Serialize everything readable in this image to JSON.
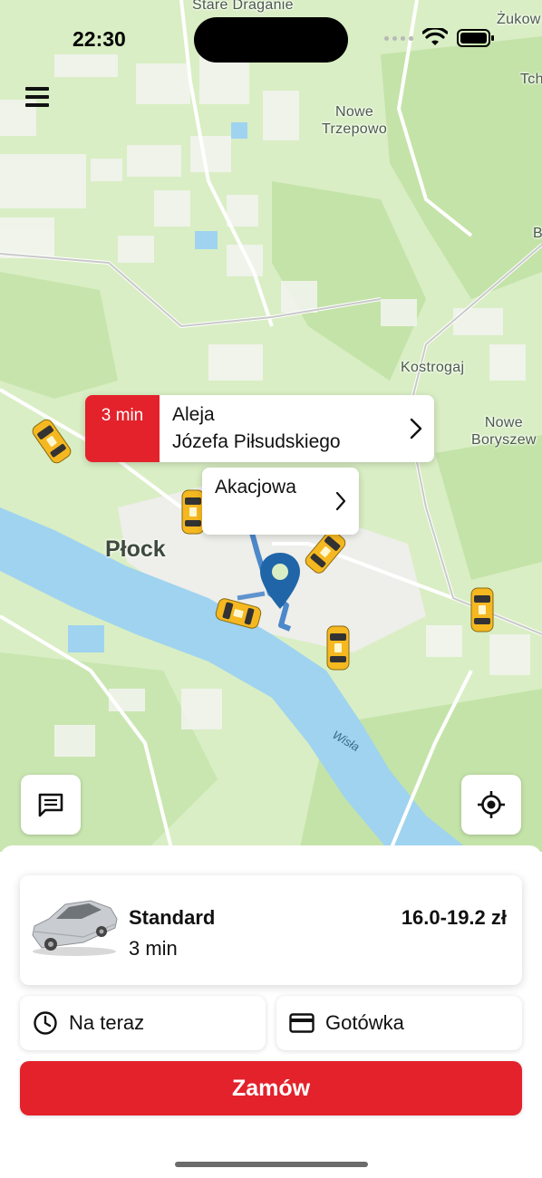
{
  "status_bar": {
    "time": "22:30"
  },
  "map": {
    "places": {
      "stare_draganie": "Stare\nDraganie",
      "zukowo": "Żukow",
      "tch": "Tch",
      "nowe_trzepowo": "Nowe\nTrzepowo",
      "b_edge": "B",
      "kostrogaj": "Kostrogaj",
      "nowe_boryszewo": "Nowe\nBoryszew",
      "city": "Płock",
      "river": "Wisła"
    },
    "pickup_callout": {
      "eta": "3 min",
      "address_line1": "Aleja",
      "address_line2": "Józefa Piłsudskiego"
    },
    "destination_callout": {
      "address": "Akacjowa"
    },
    "taxi_label": "TAXI"
  },
  "ride": {
    "name": "Standard",
    "eta": "3 min",
    "price": "16.0-19.2 zł"
  },
  "options": {
    "time": "Na teraz",
    "payment": "Gotówka"
  },
  "order_button": "Zamów",
  "colors": {
    "accent": "#e3222b",
    "route": "#3a7cc7",
    "pin": "#1f65a8",
    "water": "#9fd3f0",
    "green": "#bfe0a5"
  },
  "icons": [
    "menu-icon",
    "wifi-icon",
    "battery-icon",
    "chevron-right-icon",
    "chat-icon",
    "locate-icon",
    "clock-icon",
    "card-icon",
    "car-icon",
    "taxi-icon",
    "location-pin-icon"
  ]
}
